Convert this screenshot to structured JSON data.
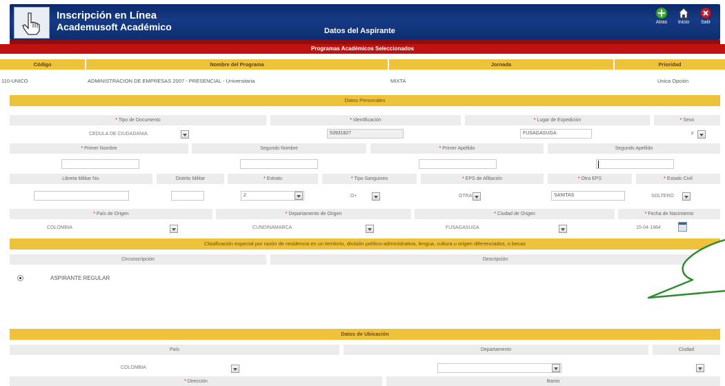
{
  "header": {
    "title_line1": "Inscripción en Línea",
    "title_line2": "Academusoft Académico",
    "page_title": "Datos del Aspirante",
    "buttons": [
      {
        "label": "Atras",
        "icon": "back-arrow-icon"
      },
      {
        "label": "Inicio",
        "icon": "home-icon"
      },
      {
        "label": "Salir",
        "icon": "exit-icon"
      }
    ]
  },
  "programs": {
    "section_title": "Programas Académicos Seleccionados",
    "columns": [
      "Código",
      "Nombre del Programa",
      "Jornada",
      "Prioridad"
    ],
    "rows": [
      {
        "code": "110-UNICO",
        "name": "ADMINISTRACION DE EMPRESAS 2007 - PRESENCIAL - Universitaria",
        "jornada": "MIXTA",
        "priority": "Unica Opción"
      }
    ]
  },
  "personal": {
    "section_title": "Datos Personales",
    "tipo_documento": {
      "label": "Tipo de Documento",
      "value": "CEDULA DE CIUDADANIA"
    },
    "identificacion": {
      "label": "Identificación",
      "value": "53931827"
    },
    "lugar_expedicion": {
      "label": "Lugar de Expedición",
      "value": "FUSAGASUGA"
    },
    "sexo": {
      "label": "Sexo",
      "value": "F"
    },
    "primer_nombre": {
      "label": "Primer Nombre",
      "value": ""
    },
    "segundo_nombre": {
      "label": "Segundo Nombre",
      "value": ""
    },
    "primer_apellido": {
      "label": "Primer Apellido",
      "value": ""
    },
    "segundo_apellido": {
      "label": "Segundo Apellido",
      "value": ""
    },
    "libreta_militar": {
      "label": "Libreta Militar No.",
      "value": ""
    },
    "distrito_militar": {
      "label": "Distrito Militar",
      "value": ""
    },
    "estrato": {
      "label": "Estrato",
      "value": "2"
    },
    "tipo_sanguineo": {
      "label": "Tipo Sanguineo",
      "value": "O+"
    },
    "eps_afiliacion": {
      "label": "EPS de Afiliación",
      "value": "OTRA"
    },
    "otra_eps": {
      "label": "Otra EPS",
      "value": "SANITAS"
    },
    "estado_civil": {
      "label": "Estado Civil",
      "value": "SOLTERO"
    },
    "pais_origen": {
      "label": "País de Origen",
      "value": "COLOMBIA"
    },
    "departamento_origen": {
      "label": "Departamento de Origen",
      "value": "CUNDINAMARCA"
    },
    "ciudad_origen": {
      "label": "Ciudad de Origen",
      "value": "FUSAGASUGA"
    },
    "fecha_nacimiento": {
      "label": "Fecha de Nacimiento",
      "value": "15-04-1984"
    }
  },
  "classification": {
    "title": "Clasificación especial por razón de residencia en un territorio, división político-administrativa, lengua, cultura u origen diferenciados, o becas",
    "columns": [
      "Circunscripción",
      "Descripción"
    ],
    "options": [
      {
        "label": "ASPIRANTE REGULAR",
        "selected": true
      }
    ]
  },
  "location": {
    "section_title": "Datos de Ubicación",
    "pais": {
      "label": "País",
      "value": "COLOMBIA"
    },
    "departamento": {
      "label": "Departamento",
      "value": ""
    },
    "ciudad": {
      "label": "Ciudad",
      "value": ""
    },
    "direccion": {
      "label": "Dirección"
    },
    "barrio": {
      "label": "Barrio"
    }
  },
  "annotation": {
    "shape": "speech-bubble",
    "color": "#2e8b2e"
  }
}
